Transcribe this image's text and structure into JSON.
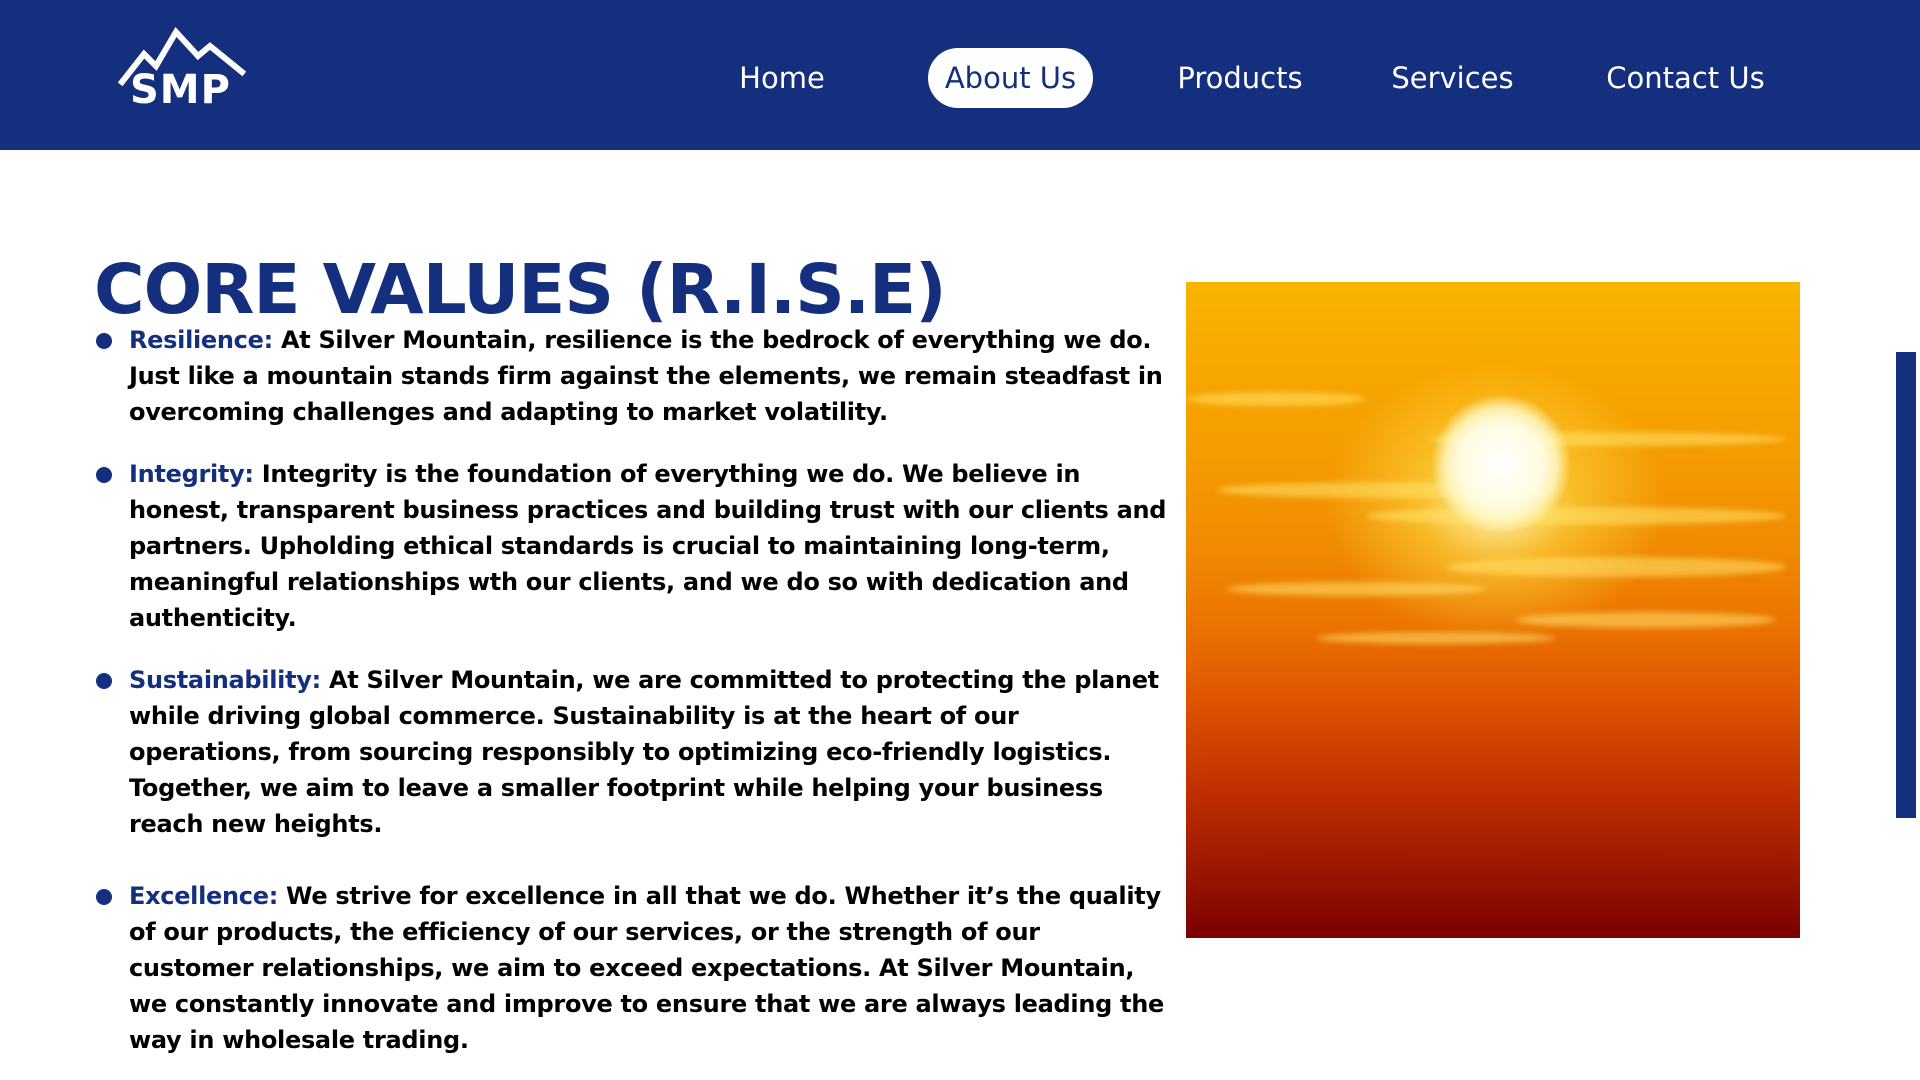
{
  "brand": {
    "logo_text": "SMP",
    "logo_icon": "mountain-icon"
  },
  "nav": {
    "items": [
      {
        "label": "Home",
        "active": false
      },
      {
        "label": "About Us",
        "active": true
      },
      {
        "label": "Products",
        "active": false
      },
      {
        "label": "Services",
        "active": false
      },
      {
        "label": "Contact Us",
        "active": false
      }
    ]
  },
  "main": {
    "title": "CORE VALUES (R.I.S.E)",
    "values": [
      {
        "term": "Resilience:",
        "text": " At Silver Mountain, resilience is the bedrock of everything we do. Just like a mountain stands firm against the elements, we remain steadfast in overcoming challenges and adapting to market volatility."
      },
      {
        "term": "Integrity:",
        "text": " Integrity is the foundation of everything we do. We believe in honest, transparent business practices and building trust with our clients and partners. Upholding ethical standards is crucial to maintaining long-term, meaningful relationships wth our clients, and we do so with dedication and authenticity."
      },
      {
        "term": "Sustainability:",
        "text": " At Silver Mountain, we are committed to protecting the planet while driving global commerce. Sustainability is at the heart of our operations, from sourcing responsibly to optimizing eco-friendly logistics. Together, we aim to leave a smaller footprint while helping your business reach new heights."
      },
      {
        "term": "Excellence:",
        "text": " We strive for excellence in all that we do. Whether it’s the quality of our products, the efficiency of our services, or the strength of our customer relationships, we aim to exceed expectations. At Silver Mountain, we constantly innovate and improve to ensure that we are always leading the way in wholesale trading."
      }
    ]
  },
  "colors": {
    "brand_navy": "#142f7e",
    "background": "#ffffff",
    "body_text": "#000000"
  }
}
